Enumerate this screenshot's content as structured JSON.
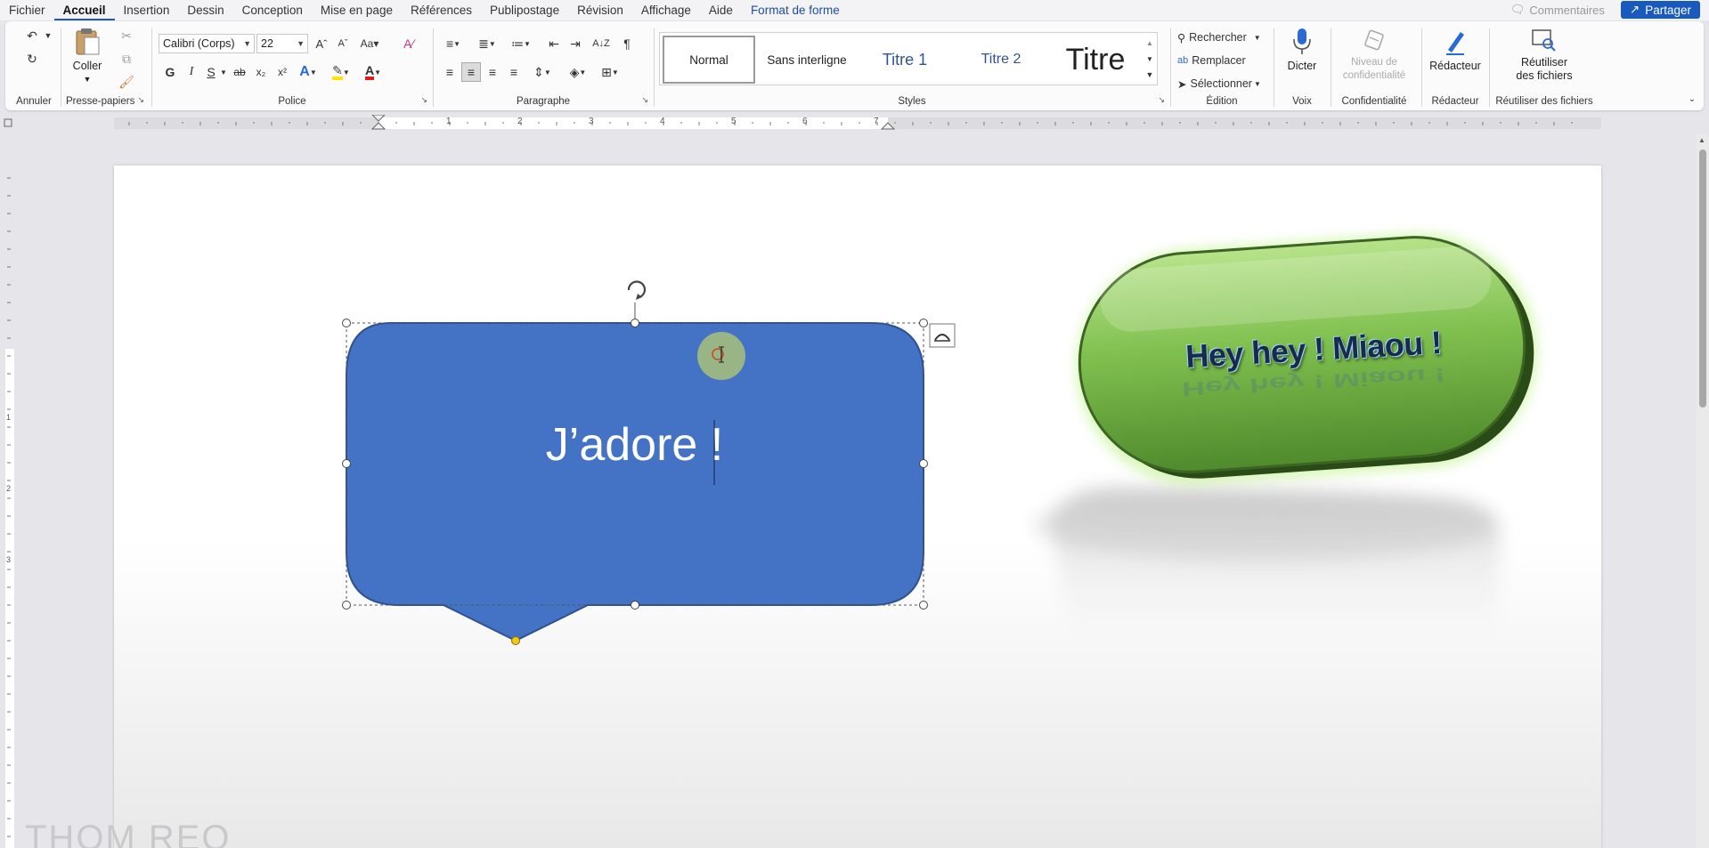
{
  "menu": {
    "tabs": [
      {
        "label": "Fichier"
      },
      {
        "label": "Accueil",
        "active": true
      },
      {
        "label": "Insertion"
      },
      {
        "label": "Dessin"
      },
      {
        "label": "Conception"
      },
      {
        "label": "Mise en page"
      },
      {
        "label": "Références"
      },
      {
        "label": "Publipostage"
      },
      {
        "label": "Révision"
      },
      {
        "label": "Affichage"
      },
      {
        "label": "Aide"
      },
      {
        "label": "Format de forme",
        "contextual": true
      }
    ],
    "comments_label": "Commentaires",
    "share_label": "Partager"
  },
  "ribbon": {
    "undo_group": "Annuler",
    "clipboard": {
      "group": "Presse-papiers",
      "paste": "Coller"
    },
    "font": {
      "group": "Police",
      "name": "Calibri (Corps)",
      "size": "22",
      "bold": "G",
      "italic": "I",
      "underline": "S",
      "strike": "ab",
      "subscript": "x₂",
      "superscript": "x²",
      "case": "Aa"
    },
    "paragraph": {
      "group": "Paragraphe"
    },
    "styles": {
      "group": "Styles",
      "items": [
        "Normal",
        "Sans interligne",
        "Titre 1",
        "Titre 2",
        "Titre"
      ]
    },
    "editing": {
      "group": "Édition",
      "find": "Rechercher",
      "replace": "Remplacer",
      "select": "Sélectionner"
    },
    "voice": {
      "group": "Voix",
      "dictate": "Dicter"
    },
    "confidentiality": {
      "group": "Confidentialité",
      "level_line1": "Niveau de",
      "level_line2": "confidentialité"
    },
    "editor": {
      "group": "Rédacteur",
      "button": "Rédacteur"
    },
    "reuse": {
      "group": "Réutiliser des fichiers",
      "line1": "Réutiliser",
      "line2": "des fichiers"
    }
  },
  "ruler": {
    "marks": [
      "1",
      "2",
      "3",
      "4",
      "5",
      "6",
      "7"
    ],
    "vmarks": [
      "1",
      "2",
      "3"
    ]
  },
  "document": {
    "callout_text": "J’adore !",
    "pill_text": "Hey hey ! Miaou !",
    "watermark": "THOM REO"
  },
  "colors": {
    "accent": "#185abd",
    "callout_fill": "#4472c4",
    "pill_green": "#6aa84f"
  }
}
